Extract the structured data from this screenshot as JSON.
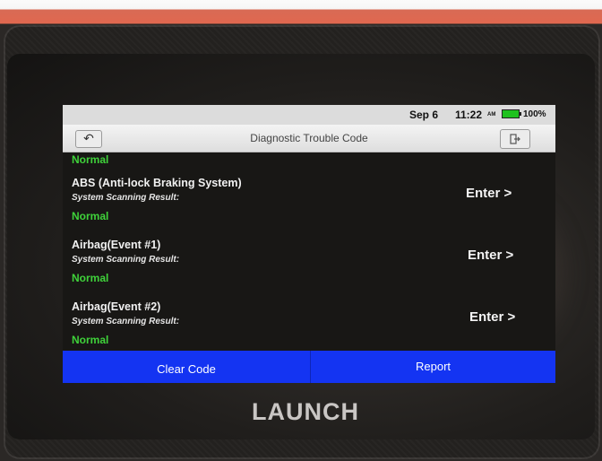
{
  "status_bar": {
    "date": "Sep 6",
    "time": "11:22",
    "ampm": "AM",
    "battery": "100%"
  },
  "header": {
    "back_icon": "back-arrow-icon",
    "title": "Diagnostic Trouble Code",
    "exit_icon": "exit-icon"
  },
  "list": {
    "top_result": "Normal",
    "systems": [
      {
        "name": "ABS (Anti-lock Braking System)",
        "subtitle": "System Scanning Result:",
        "result": "Normal",
        "action": "Enter >"
      },
      {
        "name": "Airbag(Event #1)",
        "subtitle": "System Scanning Result:",
        "result": "Normal",
        "action": "Enter >"
      },
      {
        "name": "Airbag(Event #2)",
        "subtitle": "System Scanning Result:",
        "result": "Normal",
        "action": "Enter >"
      }
    ]
  },
  "footer": {
    "clear_code": "Clear Code",
    "report": "Report"
  },
  "device": {
    "brand": "LAUNCH"
  },
  "colors": {
    "result_green": "#3fd23a",
    "button_blue": "#1434f2",
    "bezel": "#23211f"
  }
}
